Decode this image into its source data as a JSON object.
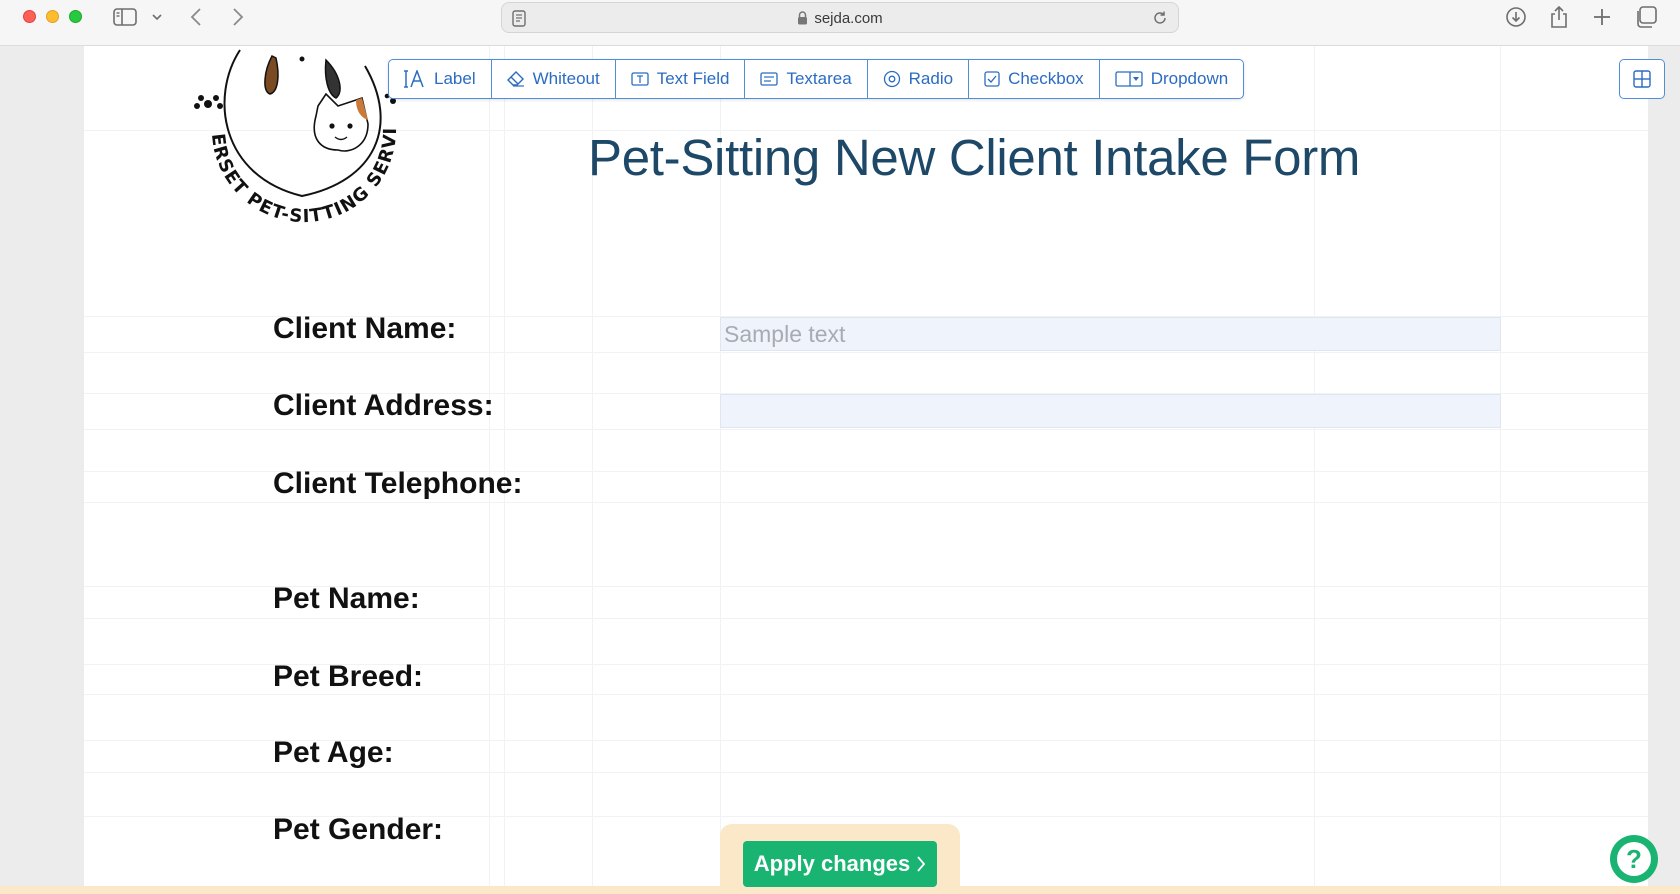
{
  "browser": {
    "url": "sejda.com"
  },
  "toolbar": {
    "tools": [
      {
        "label": "Label",
        "icon": "label-icon"
      },
      {
        "label": "Whiteout",
        "icon": "eraser-icon"
      },
      {
        "label": "Text Field",
        "icon": "text-field-icon"
      },
      {
        "label": "Textarea",
        "icon": "textarea-icon"
      },
      {
        "label": "Radio",
        "icon": "radio-icon"
      },
      {
        "label": "Checkbox",
        "icon": "checkbox-icon"
      },
      {
        "label": "Dropdown",
        "icon": "dropdown-icon"
      }
    ]
  },
  "document": {
    "title": "Pet-Sitting New Client Intake Form",
    "logo_text": "SOMERSET PET-SITTING SERVICES",
    "fields": {
      "client_name": "Client Name:",
      "client_address": "Client Address:",
      "client_telephone": "Client Telephone:",
      "pet_name": "Pet Name:",
      "pet_breed": "Pet Breed:",
      "pet_age": "Pet Age:",
      "pet_gender": "Pet Gender:"
    },
    "inputs": {
      "client_name": {
        "value": "",
        "placeholder": "Sample text"
      },
      "client_address": {
        "value": "",
        "placeholder": ""
      }
    }
  },
  "actions": {
    "apply_label": "Apply changes",
    "help_label": "?"
  },
  "colors": {
    "title": "#1e4868",
    "toolbar_accent": "#2a6cc2",
    "apply_green": "#1ab472",
    "input_fill": "#eef3fc"
  }
}
